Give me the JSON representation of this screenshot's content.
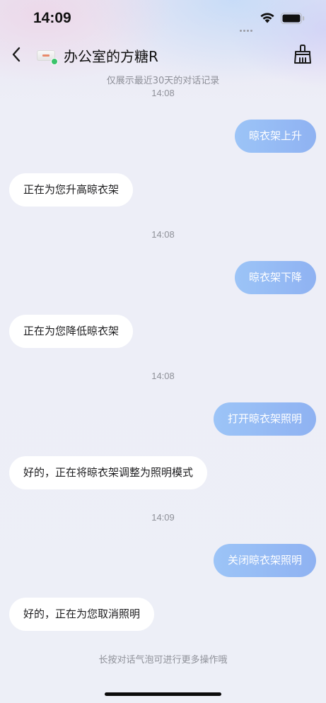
{
  "status_bar": {
    "time": "14:09"
  },
  "nav": {
    "title": "办公室的方糖R",
    "device_status_color": "#3ac36b"
  },
  "notice": "仅展示最近30天的对话记录",
  "messages": [
    {
      "kind": "timestamp",
      "text": "14:08"
    },
    {
      "kind": "outgoing",
      "text": "晾衣架上升"
    },
    {
      "kind": "incoming",
      "text": "正在为您升高晾衣架"
    },
    {
      "kind": "timestamp",
      "text": "14:08"
    },
    {
      "kind": "outgoing",
      "text": "晾衣架下降"
    },
    {
      "kind": "incoming",
      "text": "正在为您降低晾衣架"
    },
    {
      "kind": "timestamp",
      "text": "14:08"
    },
    {
      "kind": "outgoing",
      "text": "打开晾衣架照明"
    },
    {
      "kind": "incoming",
      "text": "好的，正在将晾衣架调整为照明模式"
    },
    {
      "kind": "timestamp",
      "text": "14:09"
    },
    {
      "kind": "outgoing",
      "text": "关闭晾衣架照明"
    },
    {
      "kind": "incoming",
      "text": "好的，正在为您取消照明"
    }
  ],
  "hint": "长按对话气泡可进行更多操作哦",
  "colors": {
    "outgoing_bubble": "#93b9f4",
    "incoming_bubble": "#ffffff"
  }
}
